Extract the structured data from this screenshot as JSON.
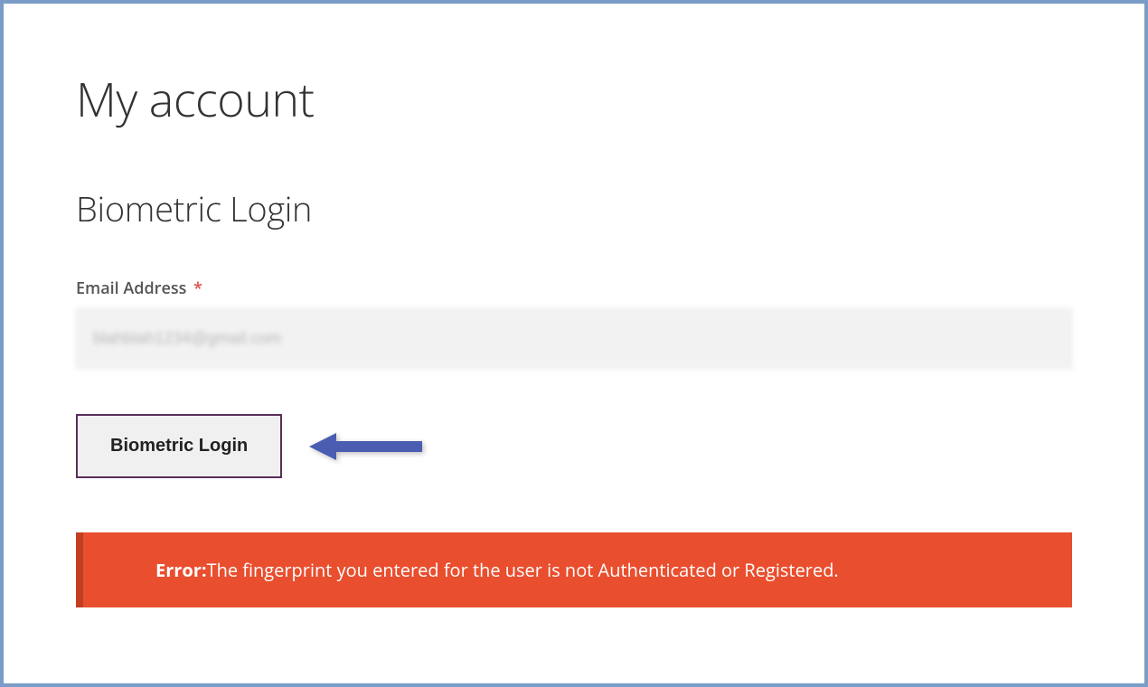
{
  "page": {
    "title": "My account",
    "subtitle": "Biometric Login"
  },
  "form": {
    "email_label": "Email Address",
    "required_mark": "*",
    "email_value": "blahblah1234@gmail.com",
    "button_label": "Biometric Login"
  },
  "error": {
    "label": "Error:",
    "message": "The fingerprint you entered for the user is not Authenticated or Registered."
  }
}
